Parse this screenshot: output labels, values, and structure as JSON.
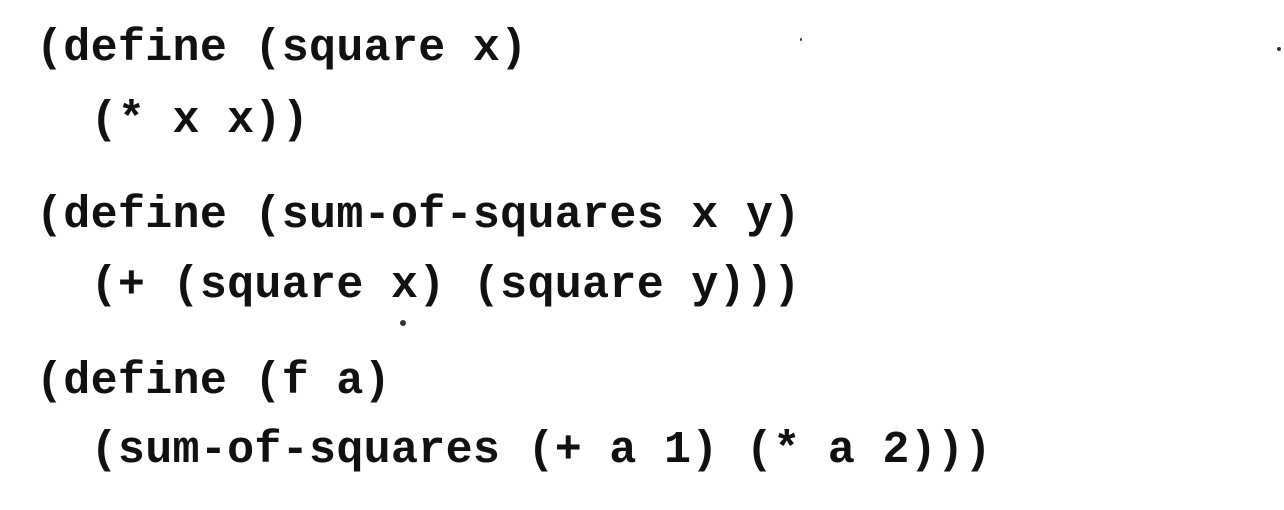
{
  "code": {
    "lines": [
      "(define (square x)",
      "  (* x x))",
      "(define (sum-of-squares x y)",
      "  (+ (square x) (square y)))",
      "(define (f a)",
      "  (sum-of-squares (+ a 1) (* a 2)))"
    ]
  }
}
